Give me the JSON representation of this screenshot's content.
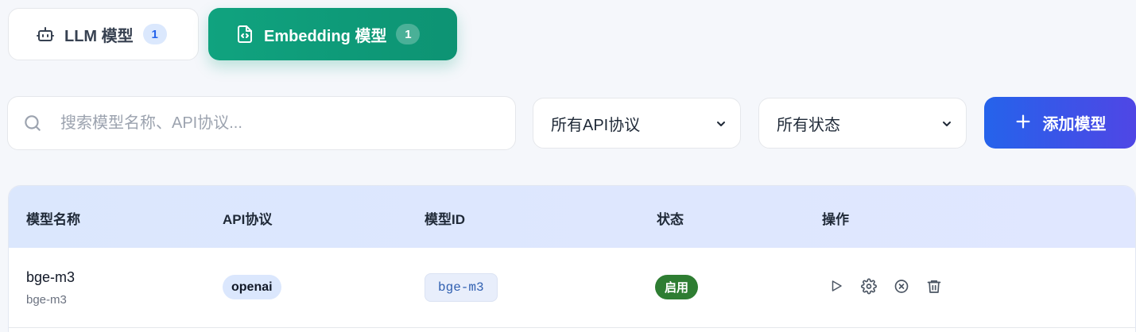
{
  "tabs": [
    {
      "label": "LLM 模型",
      "count": "1",
      "icon": "robot-icon",
      "active": false
    },
    {
      "label": "Embedding 模型",
      "count": "1",
      "icon": "code-file-icon",
      "active": true
    }
  ],
  "search": {
    "placeholder": "搜索模型名称、API协议...",
    "value": ""
  },
  "filters": {
    "api_protocol": {
      "selected": "所有API协议"
    },
    "status": {
      "selected": "所有状态"
    }
  },
  "add_button": {
    "label": "添加模型",
    "icon": "plus-icon"
  },
  "table": {
    "headers": [
      "模型名称",
      "API协议",
      "模型ID",
      "状态",
      "操作"
    ],
    "rows": [
      {
        "name": "bge-m3",
        "subname": "bge-m3",
        "api_protocol": "openai",
        "model_id": "bge-m3",
        "status": "启用",
        "actions": [
          "play-icon",
          "gear-icon",
          "close-circle-icon",
          "trash-icon"
        ]
      }
    ]
  },
  "colors": {
    "active_tab": "#10a37f",
    "primary_button": "#2563eb",
    "status_enabled": "#2e7d32",
    "header_bg": "#dbe7fd"
  }
}
